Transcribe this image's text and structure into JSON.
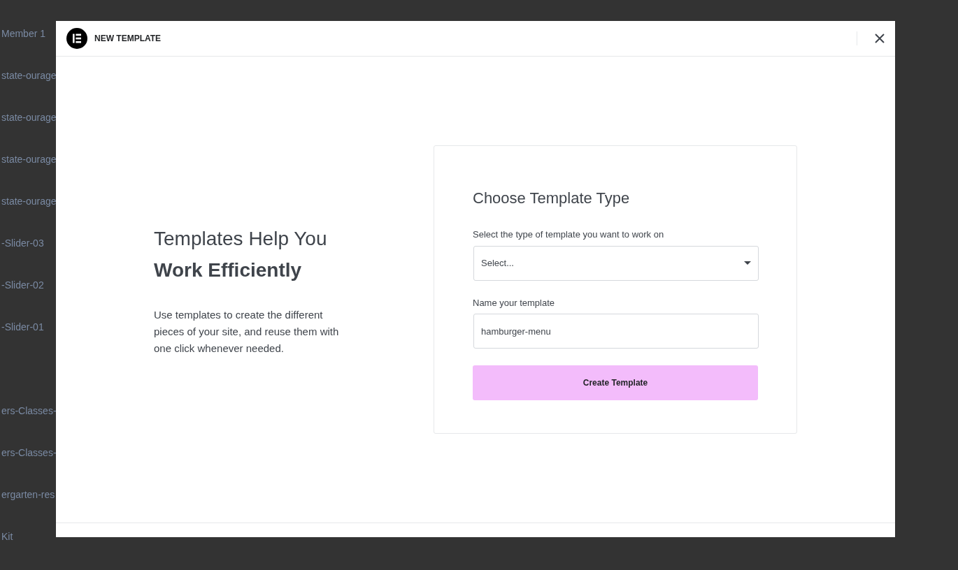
{
  "background_list": [
    {
      "label": "Member 1"
    },
    {
      "label": "state-ourage"
    },
    {
      "label": "state-ourage"
    },
    {
      "label": "state-ourage"
    },
    {
      "label": "state-ourage"
    },
    {
      "label": "-Slider-03"
    },
    {
      "label": "-Slider-02"
    },
    {
      "label": "-Slider-01"
    },
    {
      "label": "ers-Classes-",
      "gap_before": true
    },
    {
      "label": "ers-Classes-"
    },
    {
      "label": "ergarten-res"
    },
    {
      "label": "Kit"
    }
  ],
  "modal": {
    "title": "NEW TEMPLATE",
    "intro": {
      "heading_light": "Templates Help You",
      "heading_bold": "Work Efficiently",
      "text": "Use templates to create the different pieces of your site, and reuse them with one click whenever needed."
    },
    "form": {
      "title": "Choose Template Type",
      "type_label": "Select the type of template you want to work on",
      "type_select": {
        "value": "Select..."
      },
      "name_label": "Name your template",
      "name_input": {
        "value": "hamburger-menu"
      },
      "submit": "Create Template"
    }
  }
}
